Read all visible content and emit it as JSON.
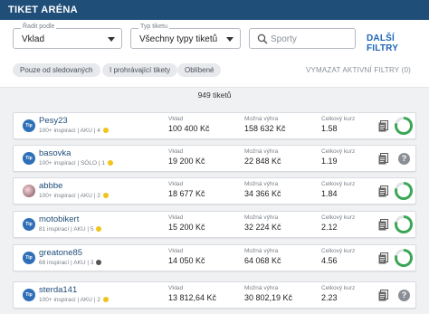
{
  "header": {
    "title": "TIKET ARÉNA"
  },
  "filters": {
    "sort": {
      "label": "Řadit podle",
      "value": "Vklad"
    },
    "type": {
      "label": "Typ tiketu",
      "value": "Všechny typy tiketů"
    },
    "search": {
      "placeholder": "Sporty"
    },
    "more_label": "DALŠÍ FILTRY",
    "chips": [
      "Pouze od sledovaných",
      "I prohrávající tikety",
      "Oblíbené"
    ],
    "clear_label": "VYMAZAT AKTIVNÍ FILTRY (0)"
  },
  "count_text": "949 tiketů",
  "columns": {
    "stake": "Vklad",
    "win": "Možná výhra",
    "odds": "Celkový kurz"
  },
  "rows": [
    {
      "avatar": "Tip",
      "name": "Pesy23",
      "inspirations": "100+ inspirací",
      "tags": "AKU",
      "level": "4",
      "stake": "100 400 Kč",
      "win": "158 632 Kč",
      "odds": "1.58",
      "status": "ring"
    },
    {
      "avatar": "Tip",
      "name": "basovka",
      "inspirations": "100+ inspirací",
      "tags": "SÓLO",
      "level": "1",
      "stake": "19 200 Kč",
      "win": "22 848 Kč",
      "odds": "1.19",
      "status": "question"
    },
    {
      "avatar": "photo",
      "name": "abbbe",
      "inspirations": "100+ inspirací",
      "tags": "AKU",
      "level": "2",
      "stake": "18 677 Kč",
      "win": "34 366 Kč",
      "odds": "1.84",
      "status": "ring"
    },
    {
      "avatar": "Tip",
      "name": "motobikert",
      "inspirations": "81 inspirací",
      "tags": "AKU",
      "level": "5",
      "stake": "15 200 Kč",
      "win": "32 224 Kč",
      "odds": "2.12",
      "status": "ring"
    },
    {
      "avatar": "Tip",
      "name": "greatone85",
      "inspirations": "68 inspirací",
      "tags": "AKU",
      "level": "3",
      "stake": "14 050 Kč",
      "win": "64 068 Kč",
      "odds": "4.56",
      "status": "ring"
    },
    {
      "avatar": "Tip",
      "name": "sterda141",
      "inspirations": "100+ inspirací",
      "tags": "AKU",
      "level": "2",
      "stake": "13 812,64 Kč",
      "win": "30 802,19 Kč",
      "odds": "2.23",
      "status": "question"
    }
  ],
  "colors": {
    "header": "#1f4e79",
    "accent": "#1f65b6",
    "ring": "#3aa655"
  }
}
